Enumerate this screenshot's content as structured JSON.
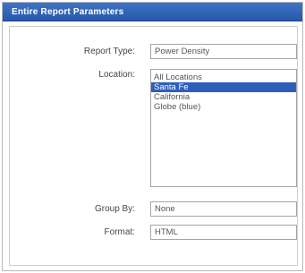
{
  "dialog": {
    "title": "Entire Report Parameters"
  },
  "form": {
    "report_type": {
      "label": "Report Type:",
      "value": "Power Density"
    },
    "location": {
      "label": "Location:",
      "options": [
        "All Locations",
        "Santa Fe",
        "California",
        "Globe (blue)"
      ],
      "selected_index": 1
    },
    "group_by": {
      "label": "Group By:",
      "value": "None"
    },
    "format": {
      "label": "Format:",
      "value": "HTML"
    }
  },
  "colors": {
    "titlebar": "#2f62b6",
    "selection": "#2f5fbd"
  }
}
